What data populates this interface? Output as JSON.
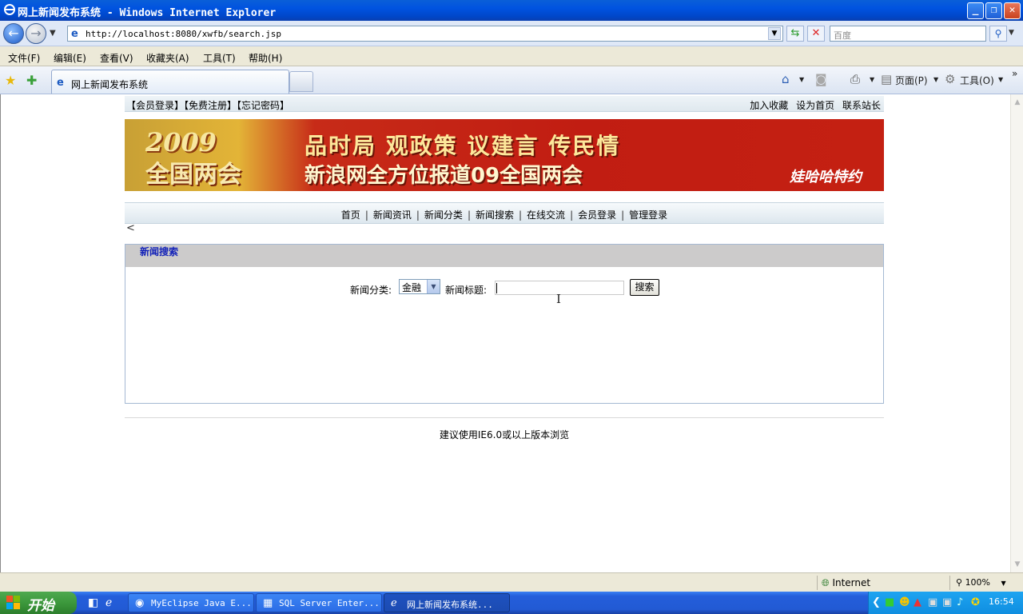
{
  "window": {
    "title": "网上新闻发布系统 - Windows Internet Explorer"
  },
  "addressbar": {
    "url": "http://localhost:8080/xwfb/search.jsp",
    "search_placeholder": "百度"
  },
  "menubar": {
    "items": [
      "文件(F)",
      "编辑(E)",
      "查看(V)",
      "收藏夹(A)",
      "工具(T)",
      "帮助(H)"
    ]
  },
  "tabs": {
    "active_label": "网上新闻发布系统"
  },
  "commandbar": {
    "page": "页面(P)",
    "tools": "工具(O)"
  },
  "page": {
    "top_left": "【会员登录】【免费注册】【忘记密码】",
    "top_right": [
      "加入收藏",
      "设为首页",
      "联系站长"
    ],
    "banner": {
      "year": "2009",
      "left_headline": "全国两会",
      "line1": "品时局 观政策 议建言 传民情",
      "line2": "新浪网全方位报道09全国两会",
      "sponsor": "娃哈哈特约"
    },
    "nav": [
      "首页",
      "新闻资讯",
      "新闻分类",
      "新闻搜索",
      "在线交流",
      "会员登录",
      "管理登录"
    ],
    "search_panel": {
      "title": "新闻搜索",
      "category_label": "新闻分类:",
      "category_value": "金融",
      "title_label": "新闻标题:",
      "title_value": "",
      "search_button": "搜索"
    },
    "footer": "建议使用IE6.0或以上版本浏览"
  },
  "statusbar": {
    "zone": "Internet",
    "zoom": "100%"
  },
  "taskbar": {
    "start_label": "开始",
    "tasks": [
      "MyEclipse Java E...",
      "SQL Server Enter...",
      "网上新闻发布系统..."
    ],
    "clock": "16:54"
  }
}
